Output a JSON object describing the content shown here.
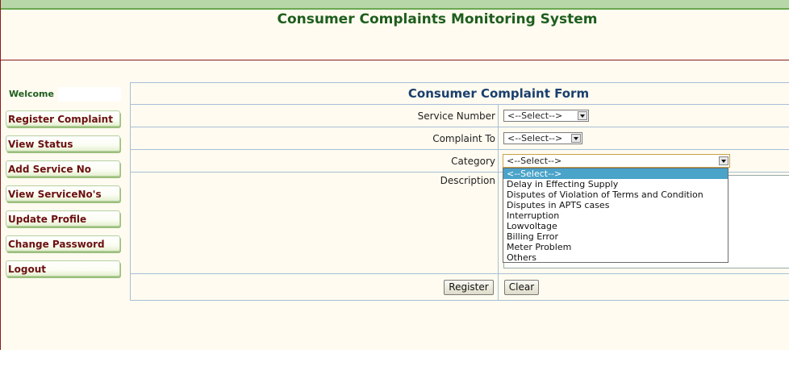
{
  "app": {
    "title": "Consumer Complaints Monitoring System"
  },
  "sidebar": {
    "welcome": "Welcome",
    "items": [
      {
        "label": "Register Complaint"
      },
      {
        "label": "View Status"
      },
      {
        "label": "Add Service No"
      },
      {
        "label": "View ServiceNo's"
      },
      {
        "label": "Update Profile"
      },
      {
        "label": "Change Password"
      },
      {
        "label": "Logout"
      }
    ]
  },
  "form": {
    "title": "Consumer Complaint Form",
    "fields": {
      "service_number": {
        "label": "Service Number",
        "value": "<--Select-->"
      },
      "complaint_to": {
        "label": "Complaint To",
        "value": "<--Select-->"
      },
      "category": {
        "label": "Category",
        "value": "<--Select-->"
      },
      "description": {
        "label": "Description",
        "value": ""
      }
    },
    "buttons": {
      "register": "Register",
      "clear": "Clear"
    }
  },
  "category_dropdown": {
    "selected_index": 0,
    "options": [
      "<--Select-->",
      "Delay in Effecting Supply",
      "Disputes of Violation of Terms and Condition",
      "Disputes in APTS cases",
      "Interruption",
      "Lowvoltage",
      "Billing Error",
      "Meter Problem",
      "Others"
    ]
  },
  "colors": {
    "page_bg": "#fffbf0",
    "title_green": "#1e5e1e",
    "nav_text": "#6b1010",
    "form_title": "#1a3f6e",
    "option_highlight": "#4aa3c9"
  }
}
